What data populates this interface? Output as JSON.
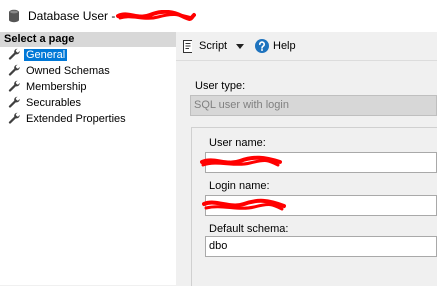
{
  "window": {
    "title": "Database User - ",
    "db_icon": "database-icon"
  },
  "nav": {
    "header": "Select a page",
    "items": [
      {
        "label": "General",
        "icon": "wrench-icon"
      },
      {
        "label": "Owned Schemas",
        "icon": "wrench-icon"
      },
      {
        "label": "Membership",
        "icon": "wrench-icon"
      },
      {
        "label": "Securables",
        "icon": "wrench-icon"
      },
      {
        "label": "Extended Properties",
        "icon": "wrench-icon"
      }
    ]
  },
  "toolbar": {
    "script_label": "Script",
    "help_label": "Help"
  },
  "form": {
    "user_type_label": "User type:",
    "user_type_value": "SQL user with login",
    "user_name_label": "User name:",
    "user_name_value": "",
    "login_name_label": "Login name:",
    "login_name_value": "",
    "default_schema_label": "Default schema:",
    "default_schema_value": "dbo"
  },
  "colors": {
    "selection": "#0078d7",
    "redaction": "#ff0000"
  }
}
